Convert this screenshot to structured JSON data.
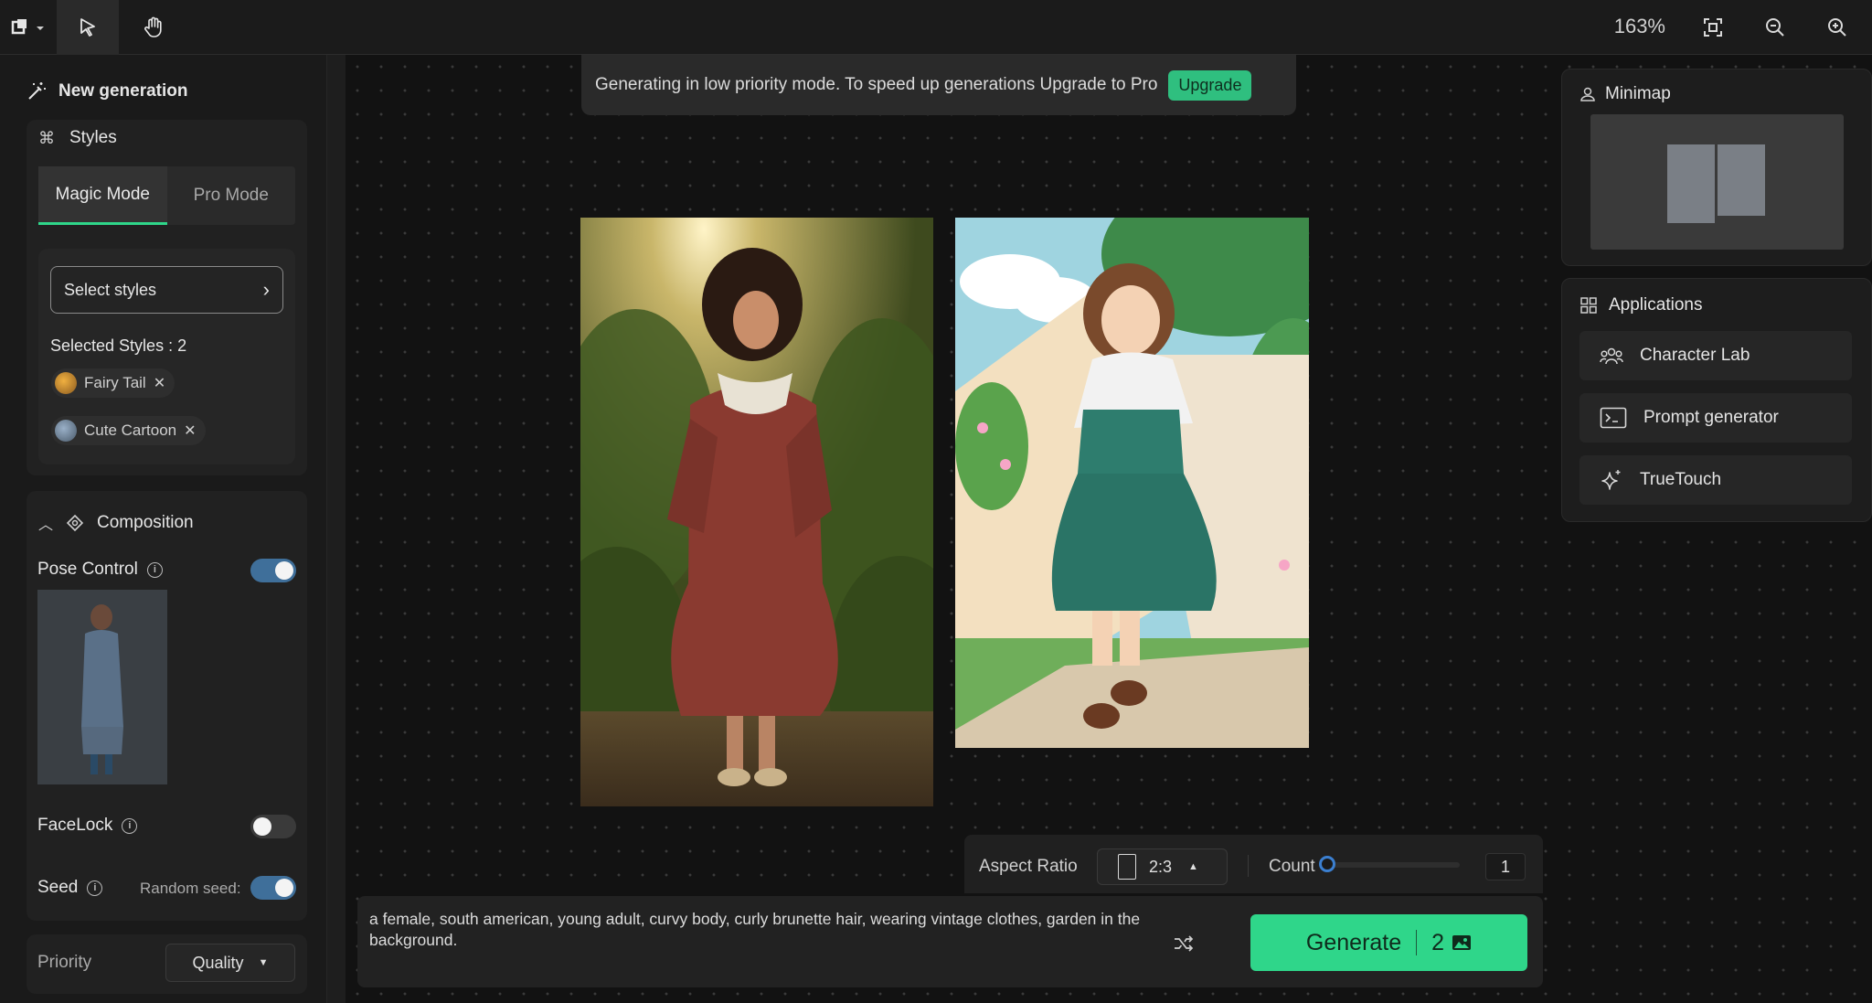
{
  "toolbar": {
    "zoom_level": "163%"
  },
  "banner": {
    "message": "Generating in low priority mode. To speed up generations Upgrade to Pro",
    "upgrade_label": "Upgrade"
  },
  "left_panel": {
    "title": "New generation",
    "styles": {
      "title": "Styles",
      "tabs": [
        {
          "label": "Magic Mode",
          "active": true
        },
        {
          "label": "Pro Mode",
          "active": false
        }
      ],
      "select_label": "Select styles",
      "selected_count_label": "Selected Styles : 2",
      "chips": [
        {
          "label": "Fairy Tail"
        },
        {
          "label": "Cute Cartoon"
        }
      ]
    },
    "composition": {
      "title": "Composition",
      "pose_control_label": "Pose Control",
      "pose_control_on": true,
      "facelock_label": "FaceLock",
      "facelock_on": false,
      "seed_label": "Seed",
      "random_seed_label": "Random seed:",
      "random_seed_on": true
    },
    "priority": {
      "label": "Priority",
      "value": "Quality"
    }
  },
  "right_panel": {
    "minimap_title": "Minimap",
    "applications_title": "Applications",
    "apps": [
      {
        "label": "Character Lab",
        "icon": "people-icon"
      },
      {
        "label": "Prompt generator",
        "icon": "terminal-icon"
      },
      {
        "label": "TrueTouch",
        "icon": "sparkle-icon"
      }
    ]
  },
  "bottom": {
    "aspect_ratio_label": "Aspect Ratio",
    "aspect_ratio_value": "2:3",
    "count_label": "Count",
    "count_value": "1",
    "prompt_text": "a female, south american, young adult, curvy body, curly brunette hair, wearing vintage clothes, garden in the background.",
    "generate_label": "Generate",
    "generate_cost": "2"
  },
  "colors": {
    "accent_green": "#2fd68a",
    "toggle_on": "#3f6f9a",
    "background": "#141414"
  }
}
